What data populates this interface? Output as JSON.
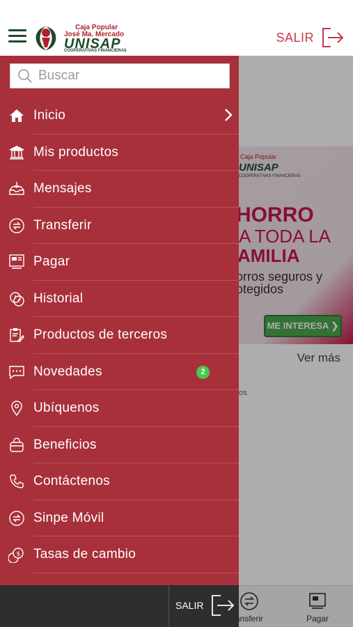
{
  "header": {
    "logo": {
      "line1": "Caja Popular",
      "line2": "José Ma. Mercado",
      "line3": "UNISAP",
      "line4": "COOPERATIVAS FINANCIERAS"
    },
    "logout_label": "SALIR"
  },
  "search": {
    "placeholder": "Buscar"
  },
  "menu": {
    "items": [
      {
        "label": "Inicio",
        "icon": "home-icon"
      },
      {
        "label": "Mis productos",
        "icon": "bank-icon"
      },
      {
        "label": "Mensajes",
        "icon": "inbox-icon"
      },
      {
        "label": "Transferir",
        "icon": "transfer-icon"
      },
      {
        "label": "Pagar",
        "icon": "pay-icon"
      },
      {
        "label": "Historial",
        "icon": "history-icon"
      },
      {
        "label": "Productos de terceros",
        "icon": "third-party-icon"
      },
      {
        "label": "Novedades",
        "icon": "chat-icon",
        "badge": "2"
      },
      {
        "label": "Ubíquenos",
        "icon": "location-icon"
      },
      {
        "label": "Beneficios",
        "icon": "bag-icon"
      },
      {
        "label": "Contáctenos",
        "icon": "phone-icon"
      },
      {
        "label": "Sinpe Móvil",
        "icon": "sinpe-icon"
      },
      {
        "label": "Tasas de cambio",
        "icon": "exchange-icon"
      }
    ]
  },
  "background": {
    "banner": {
      "brand1": "Caja Popular",
      "brand2": "UNISAP",
      "brand3": "COOPERATIVAS FINANCIERAS",
      "headline1": "HORRO",
      "headline2": "A TODA LA",
      "headline3": "AMILIA",
      "text1": "orros seguros y",
      "text2": "otegidos",
      "cta": "ME INTERESA ❯"
    },
    "see_more": "Ver más",
    "small_text": "os."
  },
  "bottom_nav": {
    "transfer_label": "ansferir",
    "pay_label": "Pagar"
  },
  "drawer_footer": {
    "logout_label": "SALIR"
  },
  "colors": {
    "drawer": "#a8303a",
    "brand_red": "#b4202a",
    "brand_green": "#1f4a2a",
    "badge": "#4cc84e"
  }
}
